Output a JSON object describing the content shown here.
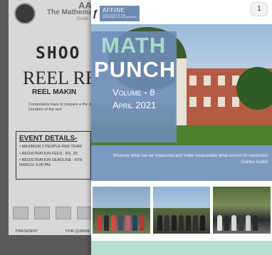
{
  "background_poster": {
    "association": "The Mathemat",
    "header_fragment": "AA",
    "header_sub": "Doubl",
    "shoot_text": "SHOO",
    "reel_text": "REEL RE",
    "reel_making": "REEL MAKIN",
    "description": "Contestants have to prepare a the day. Duration of the reel",
    "event_title": "EVENT DETAILS-",
    "event_lines": [
      "• MAXIMUM 2 PEOPLE PER TEAM",
      "• REGISTRATION FEES : RS. 20",
      "• REGISTRATION DEADLINE : 6TH MARCH, 5:00 PM"
    ],
    "president": "PRESIDENT",
    "queries": "FOR QUERIE"
  },
  "header": {
    "brand": "AFFINE",
    "brand_sub": "ASSOCIATION OF THE DEPARTMENT OF MATHEMATICS",
    "page_number": "1"
  },
  "cover": {
    "title_line1": "MATH",
    "title_line2": "PUNCH",
    "volume": "Volume - 8",
    "date": "April 2021"
  },
  "quote": {
    "text": "Measure what can be measured and make measurable what cannot be measured",
    "author": "-Galileo Galilei"
  },
  "colors": {
    "overlay": "#6e8cb9",
    "title_math": "#a6dccb",
    "quote_band": "#7c99c0",
    "footer": "#b8ddd3"
  }
}
